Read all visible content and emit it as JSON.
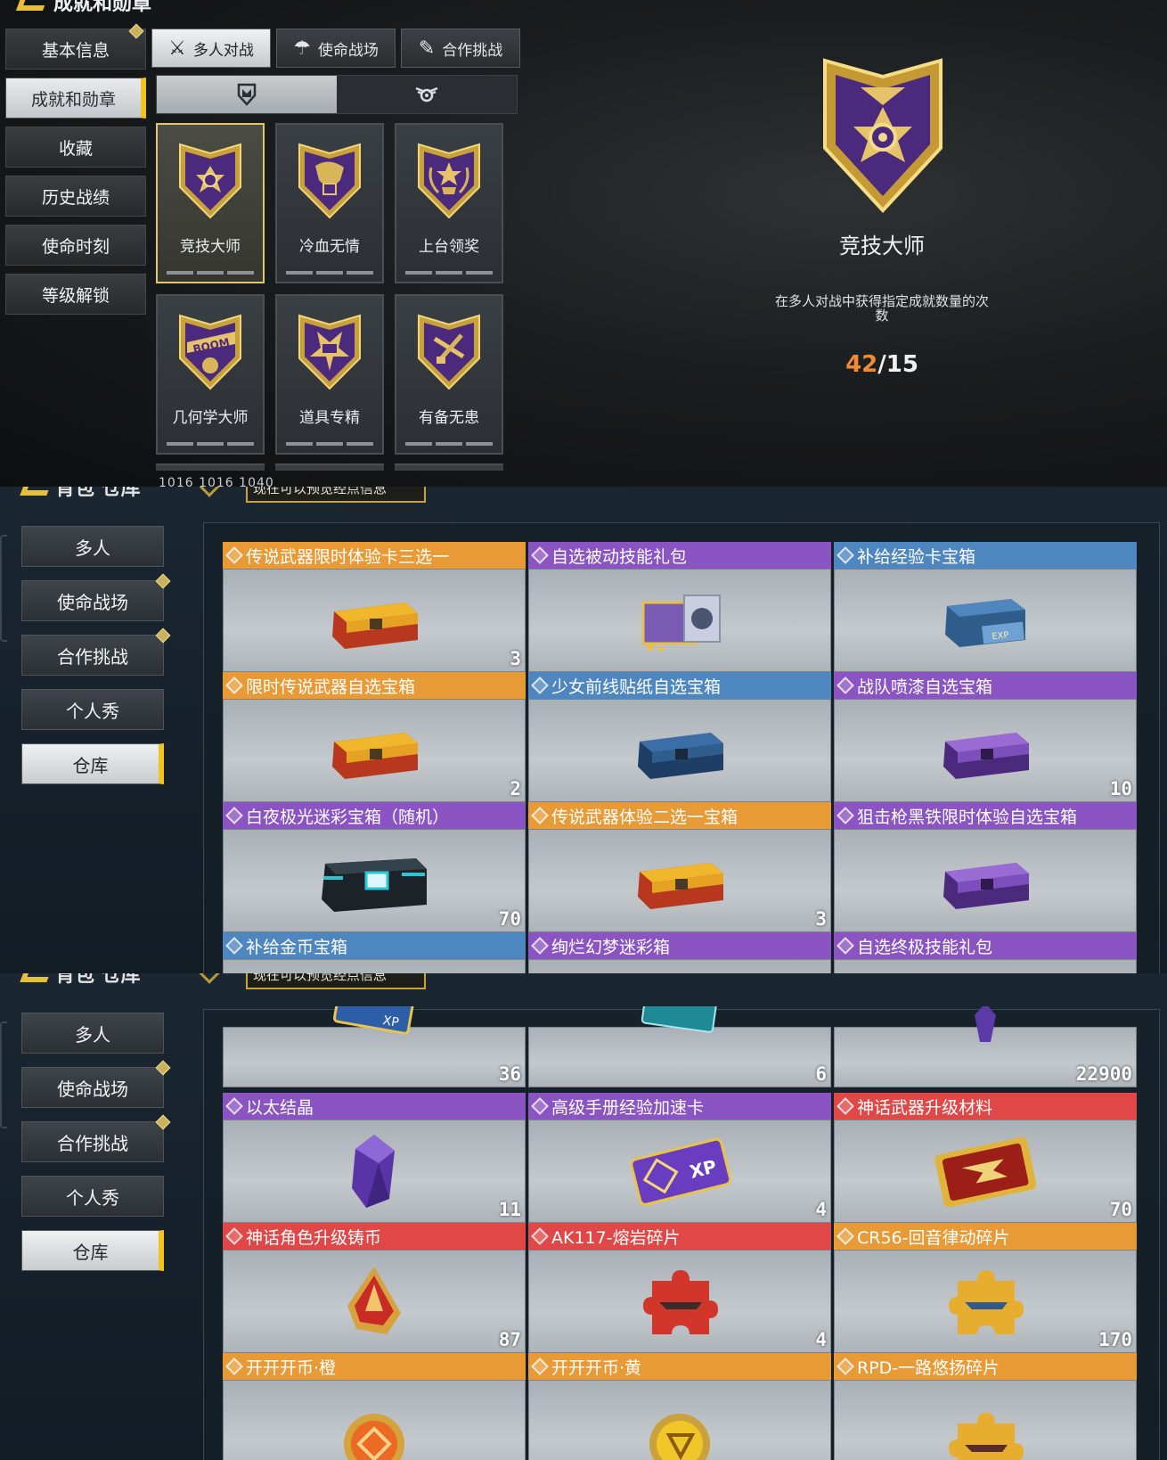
{
  "achievements": {
    "header_title": "成就和勋章",
    "nav": [
      {
        "label": "基本信息",
        "active": false,
        "badge": true
      },
      {
        "label": "成就和勋章",
        "active": true,
        "badge": false
      },
      {
        "label": "收藏",
        "active": false,
        "badge": false
      },
      {
        "label": "历史战绩",
        "active": false,
        "badge": false
      },
      {
        "label": "使命时刻",
        "active": false,
        "badge": false
      },
      {
        "label": "等级解锁",
        "active": false,
        "badge": false
      }
    ],
    "mode_tabs": [
      {
        "label": "多人对战",
        "active": true,
        "icon": "crossed-rifles-icon"
      },
      {
        "label": "使命战场",
        "active": false,
        "icon": "parachute-icon"
      },
      {
        "label": "合作挑战",
        "active": false,
        "icon": "knife-icon"
      }
    ],
    "sub_tabs": [
      {
        "icon": "medal-shield-icon",
        "active": true
      },
      {
        "icon": "winged-emblem-icon",
        "active": false
      }
    ],
    "medals": [
      {
        "name": "竞技大师",
        "active": true,
        "emblem": "cross-medal"
      },
      {
        "name": "冷血无情",
        "active": false,
        "emblem": "dragon"
      },
      {
        "name": "上台领奖",
        "active": false,
        "emblem": "trophy"
      },
      {
        "name": "几何学大师",
        "active": false,
        "emblem": "boom-grenade"
      },
      {
        "name": "道具专精",
        "active": false,
        "emblem": "bomb"
      },
      {
        "name": "有备无患",
        "active": false,
        "emblem": "tools"
      }
    ],
    "bottom_strip": "1016  1016  1040",
    "detail": {
      "name": "竞技大师",
      "description": "在多人对战中获得指定成就数量的次数",
      "progress_current": "42",
      "progress_target": "/15"
    }
  },
  "warehouse1": {
    "header_title": "背包  仓库",
    "banner": "现在可以预览经点信息",
    "nav": [
      {
        "label": "多人",
        "active": false,
        "badge": false
      },
      {
        "label": "使命战场",
        "active": false,
        "badge": true
      },
      {
        "label": "合作挑战",
        "active": false,
        "badge": true
      },
      {
        "label": "个人秀",
        "active": false,
        "badge": false
      },
      {
        "label": "仓库",
        "active": true,
        "badge": false
      }
    ],
    "items": [
      {
        "name": "传说武器限时体验卡三选一",
        "rarity": "orange",
        "icon": "gold-crate",
        "count": "3"
      },
      {
        "name": "自选被动技能礼包",
        "rarity": "purple",
        "icon": "skill-pack",
        "count": ""
      },
      {
        "name": "补给经验卡宝箱",
        "rarity": "blue",
        "icon": "blue-xp-crate",
        "count": ""
      },
      {
        "name": "限时传说武器自选宝箱",
        "rarity": "orange",
        "icon": "gold-crate",
        "count": "2"
      },
      {
        "name": "少女前线贴纸自选宝箱",
        "rarity": "blue",
        "icon": "blue-crate",
        "count": ""
      },
      {
        "name": "战队喷漆自选宝箱",
        "rarity": "purple",
        "icon": "purple-crate",
        "count": "10"
      },
      {
        "name": "白夜极光迷彩宝箱（随机）",
        "rarity": "purple",
        "icon": "teal-crate",
        "count": "70"
      },
      {
        "name": "传说武器体验二选一宝箱",
        "rarity": "orange",
        "icon": "gold-crate",
        "count": "3"
      },
      {
        "name": "狙击枪黑铁限时体验自选宝箱",
        "rarity": "purple",
        "icon": "purple-crate",
        "count": ""
      },
      {
        "name": "补给金币宝箱",
        "rarity": "blue",
        "icon": "",
        "count": ""
      },
      {
        "name": "绚烂幻梦迷彩箱",
        "rarity": "purple",
        "icon": "",
        "count": ""
      },
      {
        "name": "自选终极技能礼包",
        "rarity": "purple",
        "icon": "",
        "count": ""
      }
    ]
  },
  "warehouse2": {
    "header_title": "背包  仓库",
    "banner": "现在可以预览经点信息",
    "nav": [
      {
        "label": "多人",
        "active": false,
        "badge": false
      },
      {
        "label": "使命战场",
        "active": false,
        "badge": true
      },
      {
        "label": "合作挑战",
        "active": false,
        "badge": true
      },
      {
        "label": "个人秀",
        "active": false,
        "badge": false
      },
      {
        "label": "仓库",
        "active": true,
        "badge": false
      }
    ],
    "partial_row": [
      {
        "icon": "blue-xp-card",
        "count": "36"
      },
      {
        "icon": "teal-card",
        "count": "6"
      },
      {
        "icon": "purple-crystal-small",
        "count": "22900"
      }
    ],
    "items": [
      {
        "name": "以太结晶",
        "rarity": "purple",
        "icon": "purple-crystal",
        "count": "11"
      },
      {
        "name": "高级手册经验加速卡",
        "rarity": "purple",
        "icon": "purple-xp-card",
        "count": "4"
      },
      {
        "name": "神话武器升级材料",
        "rarity": "red",
        "icon": "red-plate",
        "count": "70"
      },
      {
        "name": "神话角色升级铸币",
        "rarity": "red",
        "icon": "red-gem",
        "count": "87"
      },
      {
        "name": "AK117-熔岩碎片",
        "rarity": "red",
        "icon": "red-puzzle",
        "count": "4"
      },
      {
        "name": "CR56-回音律动碎片",
        "rarity": "orange",
        "icon": "gold-puzzle",
        "count": "170"
      },
      {
        "name": "开开开币·橙",
        "rarity": "orange",
        "icon": "orange-coin",
        "count": ""
      },
      {
        "name": "开开开币·黄",
        "rarity": "orange",
        "icon": "yellow-coin",
        "count": ""
      },
      {
        "name": "RPD-一路悠扬碎片",
        "rarity": "orange",
        "icon": "gold-puzzle",
        "count": ""
      }
    ]
  },
  "colors": {
    "accent_gold": "#f2c21e",
    "rarity_orange": "#e89a37",
    "rarity_purple": "#8a55c2",
    "rarity_blue": "#4e86bf",
    "rarity_red": "#e04848",
    "progress_current": "#f08a34"
  }
}
